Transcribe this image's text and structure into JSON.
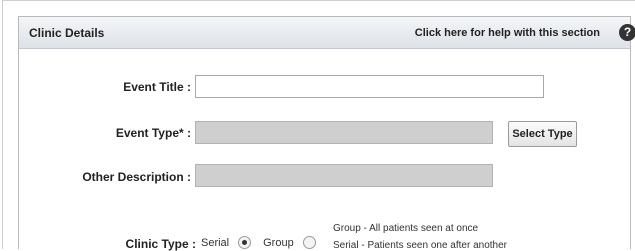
{
  "header": {
    "title": "Clinic Details",
    "help_link": "Click here for help with this section",
    "help_icon": "?"
  },
  "form": {
    "event_title": {
      "label": "Event Title :",
      "value": ""
    },
    "event_type": {
      "label": "Event Type* :",
      "value": "",
      "button_label": "Select Type"
    },
    "other_description": {
      "label": "Other Description :",
      "value": ""
    },
    "clinic_type": {
      "label": "Clinic Type :",
      "options": [
        {
          "label": "Serial",
          "checked": true
        },
        {
          "label": "Group",
          "checked": false
        }
      ],
      "notes": [
        "Group - All patients seen at once",
        "Serial - Patients seen one after another"
      ]
    }
  },
  "colors": {
    "header_gradient_top": "#f4f6f8",
    "header_gradient_bottom": "#dde2e7",
    "disabled_field": "#cfcfcf"
  }
}
